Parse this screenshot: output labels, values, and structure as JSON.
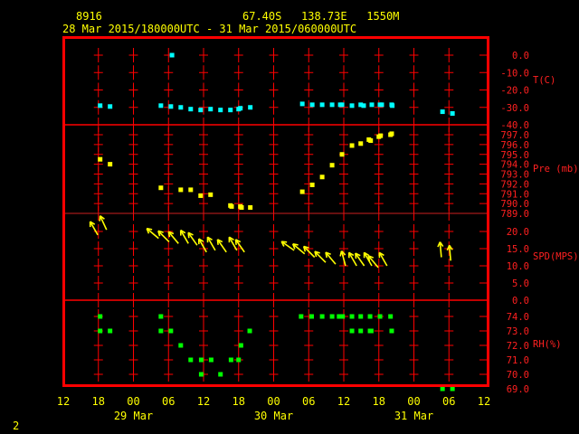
{
  "header": {
    "station": "8916",
    "location": "67.40S   138.73E   1550M",
    "period": "28 Mar 2015/180000UTC - 31 Mar 2015/060000UTC"
  },
  "footer": {
    "page": "2"
  },
  "colors": {
    "frame": "#ff0000",
    "temp": "#00ffff",
    "pressure": "#ffff00",
    "wind": "#ffff00",
    "rh": "#00ff00",
    "text": "#ffff00"
  },
  "chart_data": {
    "type": "scatter",
    "title": "8916   67.40S   138.73E   1550M",
    "subtitle": "28 Mar 2015/180000UTC - 31 Mar 2015/060000UTC",
    "x_units": "hours since 28 Mar 2015 12 UTC",
    "xlim": [
      0,
      72
    ],
    "x_ticks": [
      {
        "h": 0,
        "label": "12"
      },
      {
        "h": 6,
        "label": "18"
      },
      {
        "h": 12,
        "label": "00"
      },
      {
        "h": 18,
        "label": "06"
      },
      {
        "h": 24,
        "label": "12"
      },
      {
        "h": 30,
        "label": "18"
      },
      {
        "h": 36,
        "label": "00"
      },
      {
        "h": 42,
        "label": "06"
      },
      {
        "h": 48,
        "label": "12"
      },
      {
        "h": 54,
        "label": "18"
      },
      {
        "h": 60,
        "label": "00"
      },
      {
        "h": 66,
        "label": "06"
      },
      {
        "h": 72,
        "label": "12"
      }
    ],
    "date_labels": [
      {
        "h": 12,
        "label": "29 Mar"
      },
      {
        "h": 36,
        "label": "30 Mar"
      },
      {
        "h": 60,
        "label": "31 Mar"
      }
    ],
    "panels": [
      {
        "id": "temp",
        "label": "T(C)",
        "ylim": [
          -40,
          0
        ],
        "ticks": [
          0,
          -10,
          -20,
          -30,
          -40
        ],
        "fmt": 1,
        "points": [
          [
            6.3,
            -29
          ],
          [
            8.0,
            -29.5
          ],
          [
            16.7,
            -29
          ],
          [
            18.6,
            0
          ],
          [
            18.4,
            -29.5
          ],
          [
            20.1,
            -30
          ],
          [
            21.8,
            -31
          ],
          [
            23.5,
            -31.5
          ],
          [
            25.2,
            -31
          ],
          [
            26.9,
            -31.5
          ],
          [
            28.6,
            -31.5
          ],
          [
            30.0,
            -31
          ],
          [
            30.3,
            -30.5
          ],
          [
            32.0,
            -30
          ],
          [
            40.9,
            -28
          ],
          [
            42.6,
            -28.5
          ],
          [
            44.3,
            -28.5
          ],
          [
            46.0,
            -28.5
          ],
          [
            47.4,
            -28.5
          ],
          [
            47.7,
            -28.5
          ],
          [
            49.4,
            -29
          ],
          [
            50.9,
            -28.5
          ],
          [
            51.4,
            -29
          ],
          [
            52.8,
            -28.5
          ],
          [
            54.2,
            -28.5
          ],
          [
            54.5,
            -28.5
          ],
          [
            56.2,
            -28.5
          ],
          [
            56.3,
            -29
          ],
          [
            64.9,
            -32.5
          ],
          [
            66.6,
            -33.5
          ]
        ]
      },
      {
        "id": "pressure",
        "label": "Pre (mb)",
        "ylim": [
          789,
          797
        ],
        "ticks": [
          797,
          796,
          795,
          794,
          793,
          792,
          791,
          790,
          789
        ],
        "fmt": 1,
        "points": [
          [
            6.3,
            794.5
          ],
          [
            8.0,
            794.0
          ],
          [
            16.7,
            791.6
          ],
          [
            20.1,
            791.4
          ],
          [
            21.8,
            791.4
          ],
          [
            23.5,
            790.8
          ],
          [
            25.2,
            790.9
          ],
          [
            28.6,
            789.8
          ],
          [
            28.8,
            789.7
          ],
          [
            30.3,
            789.7
          ],
          [
            30.5,
            789.6
          ],
          [
            32.0,
            789.6
          ],
          [
            40.9,
            791.2
          ],
          [
            42.6,
            791.9
          ],
          [
            44.3,
            792.7
          ],
          [
            46.0,
            793.9
          ],
          [
            47.7,
            795.0
          ],
          [
            49.4,
            795.9
          ],
          [
            50.9,
            796.1
          ],
          [
            52.3,
            796.5
          ],
          [
            52.6,
            796.4
          ],
          [
            54.0,
            796.8
          ],
          [
            54.3,
            796.9
          ],
          [
            56.0,
            797.0
          ],
          [
            56.2,
            797.1
          ]
        ]
      },
      {
        "id": "wind",
        "label": "SPD(MPS)",
        "ylim": [
          0,
          20
        ],
        "ticks": [
          20,
          15,
          10,
          5,
          0
        ],
        "fmt": 1,
        "points": [
          [
            5.9,
            19,
            150
          ],
          [
            7.4,
            20.5,
            155
          ],
          [
            16.3,
            18,
            130
          ],
          [
            18.1,
            17,
            135
          ],
          [
            19.7,
            16.5,
            140
          ],
          [
            21.4,
            16.5,
            150
          ],
          [
            22.9,
            16,
            145
          ],
          [
            24.5,
            14,
            150
          ],
          [
            26.0,
            14.5,
            150
          ],
          [
            27.9,
            14,
            145
          ],
          [
            29.7,
            14.5,
            150
          ],
          [
            31.0,
            14,
            145
          ],
          [
            39.5,
            14.5,
            125
          ],
          [
            41.3,
            13.5,
            130
          ],
          [
            43.0,
            12.5,
            135
          ],
          [
            44.9,
            11,
            135
          ],
          [
            46.6,
            10.5,
            140
          ],
          [
            48.3,
            10,
            165
          ],
          [
            50.2,
            10,
            150
          ],
          [
            51.5,
            10,
            145
          ],
          [
            52.8,
            10,
            150
          ],
          [
            53.9,
            9.5,
            140
          ],
          [
            55.4,
            10,
            150
          ],
          [
            64.7,
            12.5,
            175
          ],
          [
            66.3,
            11.5,
            175
          ]
        ]
      },
      {
        "id": "rh",
        "label": "RH(%)",
        "ylim": [
          70,
          74
        ],
        "ticks": [
          74,
          73,
          72,
          71,
          70,
          69
        ],
        "fmt": 1,
        "points": [
          [
            6.3,
            74
          ],
          [
            16.7,
            74
          ],
          [
            40.7,
            74
          ],
          [
            42.5,
            74
          ],
          [
            44.3,
            74
          ],
          [
            46.0,
            74
          ],
          [
            47.2,
            74
          ],
          [
            47.8,
            74
          ],
          [
            49.4,
            74
          ],
          [
            50.9,
            74
          ],
          [
            52.5,
            74
          ],
          [
            54.2,
            74
          ],
          [
            56.0,
            74
          ],
          [
            6.3,
            73
          ],
          [
            8.0,
            73
          ],
          [
            16.7,
            73
          ],
          [
            18.4,
            73
          ],
          [
            31.9,
            73
          ],
          [
            49.4,
            73
          ],
          [
            50.9,
            73
          ],
          [
            52.5,
            73
          ],
          [
            52.7,
            73
          ],
          [
            56.2,
            73
          ],
          [
            20.1,
            72
          ],
          [
            30.4,
            72
          ],
          [
            21.8,
            71
          ],
          [
            23.6,
            71
          ],
          [
            25.3,
            71
          ],
          [
            28.7,
            71
          ],
          [
            30.0,
            71
          ],
          [
            23.6,
            70
          ],
          [
            26.9,
            70
          ],
          [
            64.9,
            69
          ],
          [
            66.6,
            69
          ]
        ]
      }
    ]
  }
}
